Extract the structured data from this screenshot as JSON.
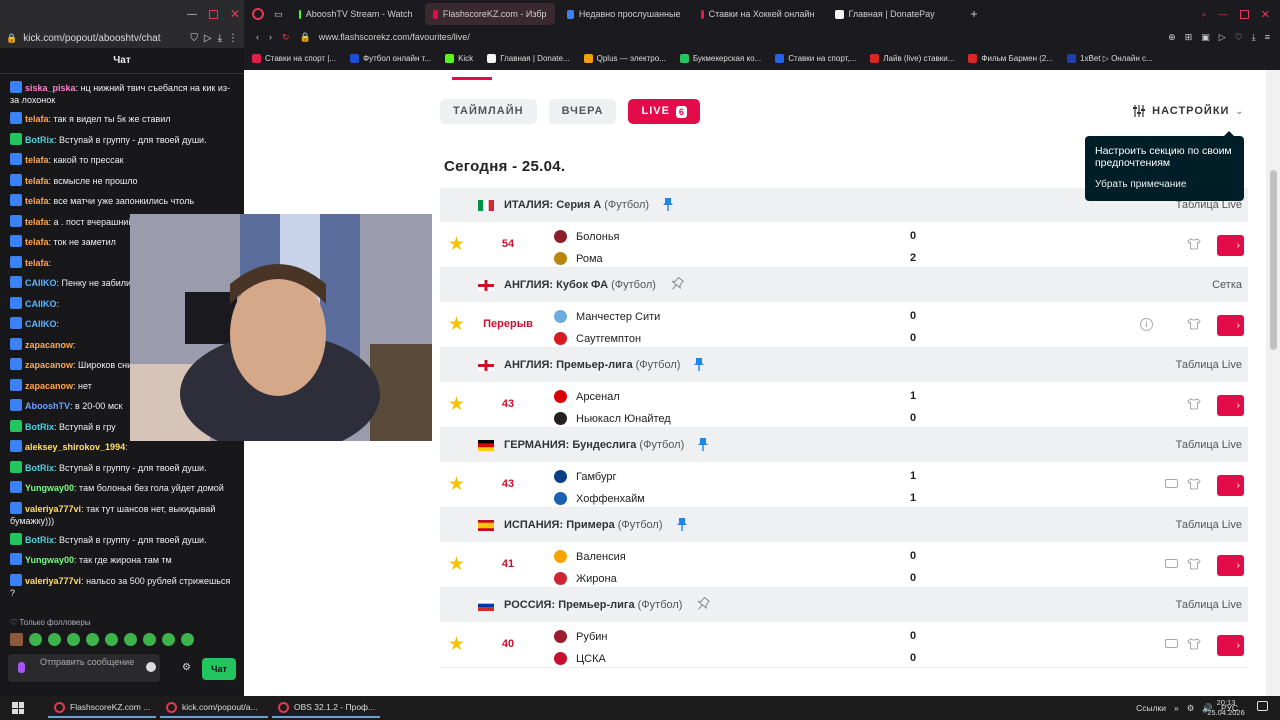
{
  "chat_window": {
    "url": "kick.com/popout/abooshtv/chat",
    "header": "Чат",
    "messages": [
      {
        "user": "siska_piska",
        "user_color": "#ff7fd0",
        "text": "нц нижний твич съебался на кик из-за лохонок",
        "wrap": true
      },
      {
        "user": "telafa",
        "user_color": "#ffa64d",
        "text": "так я видел ты 5к же ставил"
      },
      {
        "user": "BotRix",
        "user_color": "#4dd0e1",
        "text": "Вступай в группу - для твоей души."
      },
      {
        "user": "telafa",
        "user_color": "#ffa64d",
        "text": "какой то прессак"
      },
      {
        "user": "telafa",
        "user_color": "#ffa64d",
        "text": "всмысле не прошло"
      },
      {
        "user": "telafa",
        "user_color": "#ffa64d",
        "text": "все матчи уже запонкились чтоль"
      },
      {
        "user": "telafa",
        "user_color": "#ffa64d",
        "text": "а . пост вчерашний"
      },
      {
        "user": "telafa",
        "user_color": "#ffa64d",
        "text": "ток не заметил"
      },
      {
        "user": "telafa",
        "user_color": "#ffa64d",
        "text": ""
      },
      {
        "user": "CAIIKO",
        "user_color": "#5fb3ff",
        "text": "Пенку не забили"
      },
      {
        "user": "CAIIKO",
        "user_color": "#5fb3ff",
        "text": ""
      },
      {
        "user": "CAIIKO",
        "user_color": "#5fb3ff",
        "text": ""
      },
      {
        "user": "zapacanow",
        "user_color": "#ffa64d",
        "text": ""
      },
      {
        "user": "zapacanow",
        "user_color": "#ffa64d",
        "text": "Широков сним"
      },
      {
        "user": "zapacanow",
        "user_color": "#ffa64d",
        "text": "нет"
      },
      {
        "user": "AbooshTV",
        "user_color": "#6aa0ff",
        "text": "в 20-00 мск"
      },
      {
        "user": "BotRix",
        "user_color": "#4dd0e1",
        "text": "Вступай в гру"
      },
      {
        "user": "aleksey_shirokov_1994",
        "user_color": "#ffe066",
        "text": ""
      },
      {
        "user": "BotRix",
        "user_color": "#4dd0e1",
        "text": "Вступай в группу - для твоей души."
      },
      {
        "user": "Yungway00",
        "user_color": "#7cfc7c",
        "text": "там болонья без гола уйдет домой"
      },
      {
        "user": "valeriya777vi",
        "user_color": "#ffe066",
        "text": "так тут шансов нет, выкидывай бумажку)))",
        "wrap": true
      },
      {
        "user": "BotRix",
        "user_color": "#4dd0e1",
        "text": "Вступай в группу - для твоей души."
      },
      {
        "user": "Yungway00",
        "user_color": "#7cfc7c",
        "text": "так где жирона там тм"
      },
      {
        "user": "valeriya777vi",
        "user_color": "#ffe066",
        "text": "нальсо за 500 рублей стрижешься ?",
        "wrap": true
      }
    ],
    "followers_only": "Только фолловеры",
    "input_placeholder": "Отправить сообщение",
    "send_label": "Чат"
  },
  "browser": {
    "tabs": [
      {
        "label": "AbooshTV Stream - Watch",
        "fav_color": "#53fc18",
        "active": false
      },
      {
        "label": "FlashscoreKZ.com - Избр",
        "fav_color": "#e30b4a",
        "active": true
      },
      {
        "label": "Недавно прослушанные",
        "fav_color": "#3b82f6",
        "active": false
      },
      {
        "label": "Ставки на Хоккей онлайн",
        "fav_color": "#e11d48",
        "active": false
      },
      {
        "label": "Главная | DonatePay",
        "fav_color": "#f5f5f5",
        "active": false
      }
    ],
    "address": "www.flashscorekz.com/favourites/live/",
    "bookmarks": [
      {
        "label": "Ставки на спорт |...",
        "fav_color": "#e11d48"
      },
      {
        "label": "Футбол онлайн т...",
        "fav_color": "#1d4ed8"
      },
      {
        "label": "Kick",
        "fav_color": "#53fc18"
      },
      {
        "label": "Главная | Donate...",
        "fav_color": "#f5f5f5"
      },
      {
        "label": "Qplus — электро...",
        "fav_color": "#f59e0b"
      },
      {
        "label": "Букмекерская ко...",
        "fav_color": "#22c55e"
      },
      {
        "label": "Ставки на спорт,...",
        "fav_color": "#2563eb"
      },
      {
        "label": "Лайв (live) ставки...",
        "fav_color": "#dc2626"
      },
      {
        "label": "Фильм Бармен (2...",
        "fav_color": "#dc2626"
      },
      {
        "label": "1xBet ▷ Онлайн с...",
        "fav_color": "#1e40af"
      }
    ]
  },
  "page": {
    "filters": {
      "timeline": "ТАЙМЛАЙН",
      "yesterday": "ВЧЕРА",
      "live": "LIVE",
      "live_count": "6"
    },
    "settings_label": "НАСТРОЙКИ",
    "tooltip": {
      "text": "Настроить секцию по своим предпочтениям",
      "action": "Убрать примечание"
    },
    "date_heading": "Сегодня - 25.04.",
    "leagues": [
      {
        "country": "ИТАЛИЯ",
        "name": "Серия А",
        "sport": "(Футбол)",
        "pinned": true,
        "right": "Таблица Live",
        "flag": "it",
        "match": {
          "stage": "54",
          "home": "Болонья",
          "away": "Рома",
          "home_score": "0",
          "away_score": "2",
          "home_logo": "#8b1d2c",
          "away_logo": "#b8860b",
          "tv": false,
          "info": false
        }
      },
      {
        "country": "АНГЛИЯ",
        "name": "Кубок ФА",
        "sport": "(Футбол)",
        "pinned": false,
        "right": "Сетка",
        "flag": "en",
        "match": {
          "stage": "Перерыв",
          "home": "Манчестер Сити",
          "away": "Саутгемптон",
          "home_score": "0",
          "away_score": "0",
          "home_logo": "#6cabdd",
          "away_logo": "#d71920",
          "tv": false,
          "info": true
        }
      },
      {
        "country": "АНГЛИЯ",
        "name": "Премьер-лига",
        "sport": "(Футбол)",
        "pinned": true,
        "right": "Таблица Live",
        "flag": "en",
        "match": {
          "stage": "43",
          "home": "Арсенал",
          "away": "Ньюкасл Юнайтед",
          "home_score": "1",
          "away_score": "0",
          "home_logo": "#db0007",
          "away_logo": "#241f20",
          "tv": false,
          "info": false
        }
      },
      {
        "country": "ГЕРМАНИЯ",
        "name": "Бундеслига",
        "sport": "(Футбол)",
        "pinned": true,
        "right": "Таблица Live",
        "flag": "de",
        "match": {
          "stage": "43",
          "home": "Гамбург",
          "away": "Хоффенхайм",
          "home_score": "1",
          "away_score": "1",
          "home_logo": "#0a3f86",
          "away_logo": "#1961b5",
          "tv": true,
          "info": false
        }
      },
      {
        "country": "ИСПАНИЯ",
        "name": "Примера",
        "sport": "(Футбол)",
        "pinned": true,
        "right": "Таблица Live",
        "flag": "es",
        "match": {
          "stage": "41",
          "home": "Валенсия",
          "away": "Жирона",
          "home_score": "0",
          "away_score": "0",
          "home_logo": "#f7a400",
          "away_logo": "#cd2534",
          "tv": true,
          "info": false
        }
      },
      {
        "country": "РОССИЯ",
        "name": "Премьер-лига",
        "sport": "(Футбол)",
        "pinned": false,
        "right": "Таблица Live",
        "flag": "ru",
        "match": {
          "stage": "40",
          "home": "Рубин",
          "away": "ЦСКА",
          "home_score": "0",
          "away_score": "0",
          "home_logo": "#9b1b30",
          "away_logo": "#c8102e",
          "tv": true,
          "info": false
        }
      }
    ]
  },
  "taskbar": {
    "apps": [
      "FlashscoreKZ.com ...",
      "kick.com/popout/a...",
      "OBS 32.1.2 - Проф..."
    ],
    "links_label": "Ссылки",
    "lang": "РУС",
    "time": "20:13",
    "date": "25.04.2026"
  }
}
